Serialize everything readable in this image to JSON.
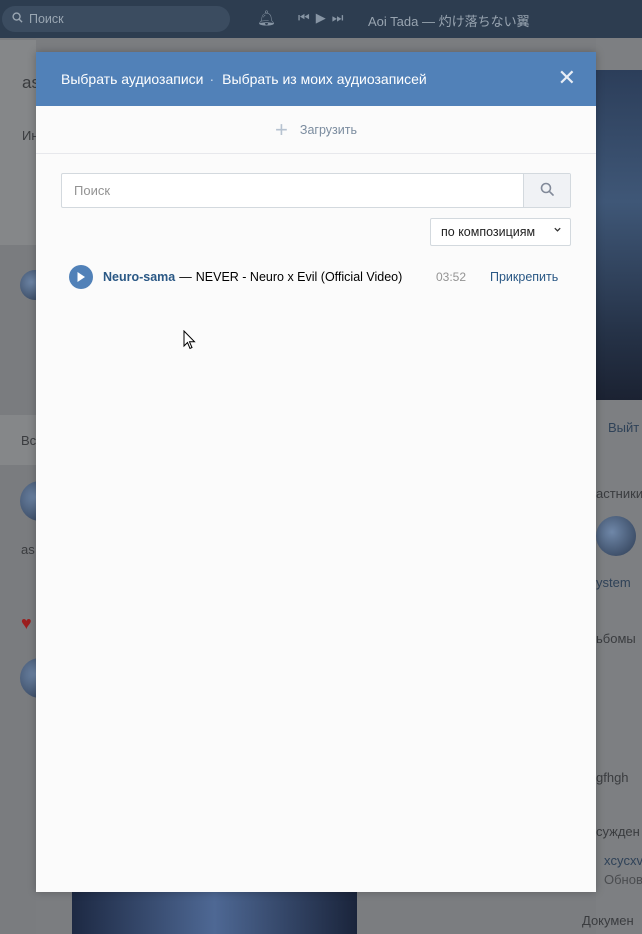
{
  "topbar": {
    "search_placeholder": "Поиск",
    "track_name": "Aoi Tada — 灼け落ちない翼",
    "icons": [
      "search-icon",
      "bell-icon",
      "prev-icon",
      "play-icon",
      "next-icon"
    ]
  },
  "background": {
    "items": [
      "as",
      "Ин",
      "Вс",
      "as",
      "астники",
      "ystem",
      "ьбомы",
      "gfhgh",
      "сужден",
      "xcycxv",
      "Обнов",
      "Докумен",
      "Выйт"
    ]
  },
  "modal": {
    "title_part1": "Выбрать аудиозаписи",
    "title_sep": "·",
    "title_part2": "Выбрать из моих аудиозаписей",
    "close_icon": "close-icon",
    "upload_label": "Загрузить",
    "search": {
      "placeholder": "Поиск",
      "value": ""
    },
    "sort": {
      "selected": "по композициям"
    },
    "tracks": [
      {
        "artist": "Neuro-sama",
        "dash": "—",
        "title": "NEVER - Neuro x Evil (Official Video)",
        "duration": "03:52",
        "action": "Прикрепить"
      }
    ]
  },
  "colors": {
    "header": "#5181b8",
    "link": "#2a5885",
    "topbar": "#2d3d50"
  }
}
